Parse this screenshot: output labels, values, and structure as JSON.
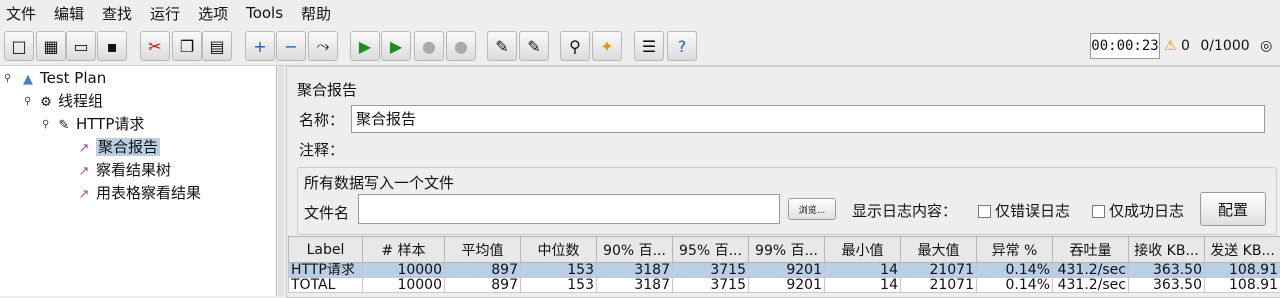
{
  "menu": [
    "文件",
    "编辑",
    "查找",
    "运行",
    "选项",
    "Tools",
    "帮助"
  ],
  "status": {
    "timer": "00:00:23",
    "warnings": "0",
    "threads": "0/1000"
  },
  "tree": {
    "root": "Test Plan",
    "thread_group": "线程组",
    "sampler": "HTTP请求",
    "listeners": [
      "聚合报告",
      "察看结果树",
      "用表格察看结果"
    ]
  },
  "panel": {
    "title": "聚合报告",
    "name_label": "名称：",
    "name_value": "聚合报告",
    "comment_label": "注释：",
    "group_title": "所有数据写入一个文件",
    "filename_label": "文件名",
    "browse_label": "浏览...",
    "log_label": "显示日志内容：",
    "errors_only": "仅错误日志",
    "success_only": "仅成功日志",
    "configure": "配置"
  },
  "table": {
    "headers": [
      "Label",
      "# 样本",
      "平均值",
      "中位数",
      "90% 百...",
      "95% 百...",
      "99% 百...",
      "最小值",
      "最大值",
      "异常 %",
      "吞吐量",
      "接收 KB...",
      "发送 KB..."
    ],
    "rows": [
      [
        "HTTP请求",
        "10000",
        "897",
        "153",
        "3187",
        "3715",
        "9201",
        "14",
        "21071",
        "0.14%",
        "431.2/sec",
        "363.50",
        "108.91"
      ],
      [
        "TOTAL",
        "10000",
        "897",
        "153",
        "3187",
        "3715",
        "9201",
        "14",
        "21071",
        "0.14%",
        "431.2/sec",
        "363.50",
        "108.91"
      ]
    ]
  }
}
